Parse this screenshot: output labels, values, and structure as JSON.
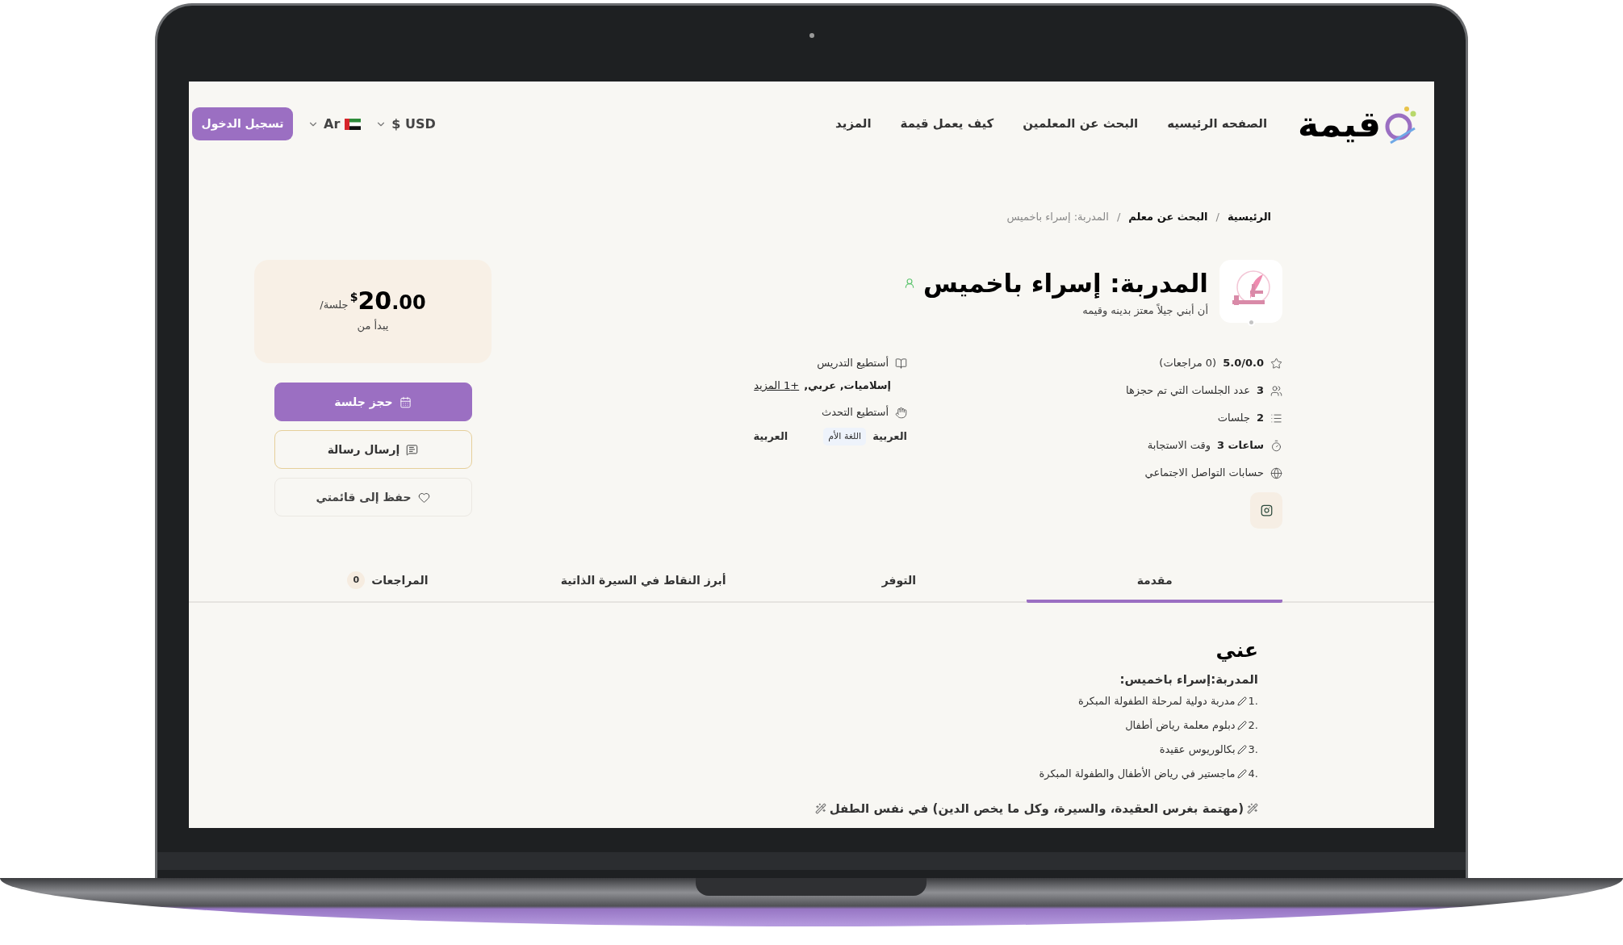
{
  "header": {
    "logo_text": "قيمة",
    "nav": [
      "الصفحه الرئيسيه",
      "البحث عن المعلمين",
      "كيف يعمل قيمة",
      "المزيد"
    ],
    "currency": "$ USD",
    "language": "Ar",
    "login_button": "تسجيل الدخول"
  },
  "breadcrumb": {
    "items": [
      {
        "label": "الرئيسية",
        "current": false
      },
      {
        "label": "البحث عن معلم",
        "current": false
      },
      {
        "label": "المدربة: إسراء باخميس",
        "current": true
      }
    ],
    "separators": [
      "/",
      "/"
    ]
  },
  "profile": {
    "name": "المدربة: إسراء باخميس",
    "tagline": "أن أبني جيلاً معتز بدينه وقيمه",
    "online": false,
    "stats": [
      {
        "kind": "rating",
        "value": "5.0/0.0",
        "label": "(0 مراجعات)"
      },
      {
        "kind": "sessions_booked",
        "value": "3",
        "label": "عدد الجلسات التي تم حجزها"
      },
      {
        "kind": "sessions",
        "value": "2",
        "label": "جلسات"
      },
      {
        "kind": "response_time",
        "value": "3 ساعات",
        "label": "وقت الاستجابة"
      },
      {
        "kind": "social",
        "label": "حسابات التواصل الاجتماعي"
      }
    ],
    "teaches": {
      "label": "أستطيع التدريس",
      "subjects": "إسلاميات, عربي,",
      "more_link": "+1 المزيد"
    },
    "speaks": {
      "label": "أستطيع التحدث",
      "languages": [
        {
          "name": "العربية",
          "badge": "اللغة الأم"
        },
        {
          "name": "العربية"
        }
      ]
    }
  },
  "pricing": {
    "amount": "20",
    "decimals": ".00",
    "currency": "$",
    "unit": "/جلسة",
    "caption": "يبدأ من",
    "actions": [
      {
        "kind": "book",
        "label": "حجز جلسة"
      },
      {
        "kind": "message",
        "label": "إرسال رسالة"
      },
      {
        "kind": "save",
        "label": "حفظ إلى قائمتي"
      }
    ]
  },
  "tabs": [
    {
      "label": "مقدمة",
      "selected": true
    },
    {
      "label": "التوفر",
      "selected": false
    },
    {
      "label": "أبرز النقاط في السيرة الذاتية",
      "selected": false
    },
    {
      "label": "المراجعات",
      "selected": false,
      "count": "0"
    }
  ],
  "about": {
    "title": "عني",
    "subtitle": "المدربة:إسراء باخميس:",
    "items": [
      {
        "number": "1.",
        "text": "مدربة دولية لمرحلة الطفولة المبكرة"
      },
      {
        "number": "2.",
        "text": "دبلوم معلمة رياض أطفال"
      },
      {
        "number": "3.",
        "text": "بكالوريوس عقيدة"
      },
      {
        "number": "4.",
        "text": "ماجستير في رياض الأطفال والطفولة المبكرة"
      }
    ],
    "note": "(مهتمة بغرس العقيدة، والسيرة، وكل ما يخص الدين) في نفس الطفل"
  }
}
